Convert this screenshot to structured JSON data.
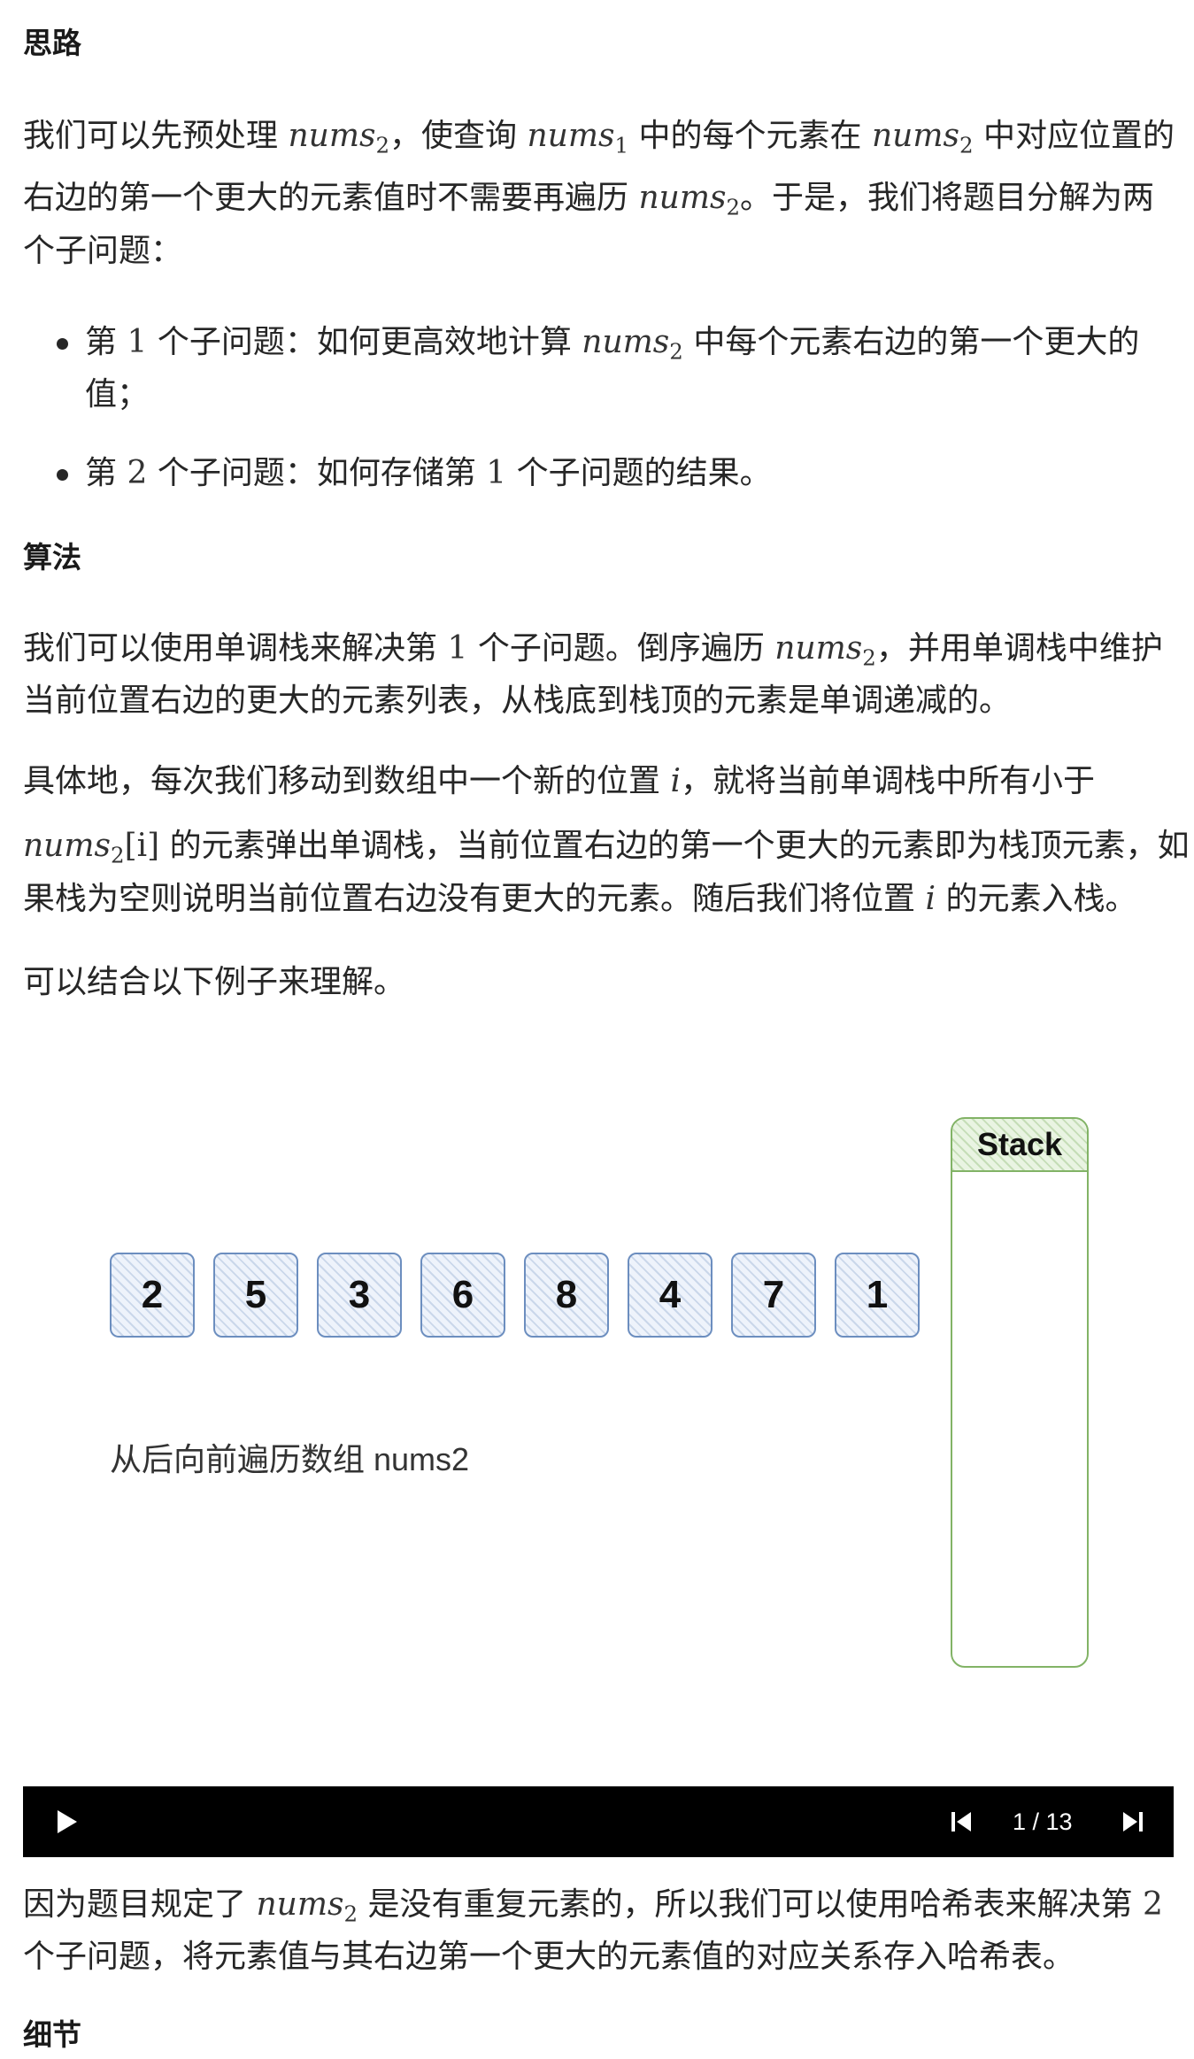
{
  "sections": {
    "thinking_title": "思路",
    "algorithm_title": "算法",
    "details_title": "细节"
  },
  "thinking": {
    "p1_l1_a": "我们可以先预处理",
    "p1_l1_b": "，使查询",
    "p1_l1_c": "中的每个元素在",
    "p1_l1_d": "中对应位置的",
    "p1_l2_a": "右边的第一个更大的元素值时不需要再遍历",
    "p1_l2_b": "。于是，我们将题目分解为两",
    "p1_l3": "个子问题：",
    "bullet1_a": "第",
    "bullet1_num": "1",
    "bullet1_b": "个子问题：如何更高效地计算",
    "bullet1_c": "中每个元素右边的第一个更大的",
    "bullet1_l2": "值；",
    "bullet2_a": "第",
    "bullet2_num": "2",
    "bullet2_b": "个子问题：如何存储第",
    "bullet2_num2": "1",
    "bullet2_c": "个子问题的结果。"
  },
  "math": {
    "nums": "nums",
    "sub1": "1",
    "sub2": "2",
    "idx": "[i]",
    "i": "i"
  },
  "algorithm": {
    "p1_l1_a": "我们可以使用单调栈来解决第",
    "p1_num": "1",
    "p1_l1_b": "个子问题。倒序遍历",
    "p1_l1_c": "，并用单调栈中维护",
    "p1_l2": "当前位置右边的更大的元素列表，从栈底到栈顶的元素是单调递减的。",
    "p2_l1_a": "具体地，每次我们移动到数组中一个新的位置",
    "p2_l1_b": "，就将当前单调栈中所有小于",
    "p2_l2_b": "的元素弹出单调栈，当前位置右边的第一个更大的元素即为栈顶元素，如",
    "p2_l3_a": "果栈为空则说明当前位置右边没有更大的元素。随后我们将位置",
    "p2_l3_b": "的元素入栈。",
    "p3": "可以结合以下例子来理解。"
  },
  "slide": {
    "array_values": [
      "2",
      "5",
      "3",
      "6",
      "8",
      "4",
      "7",
      "1"
    ],
    "stack_label": "Stack",
    "caption": "从后向前遍历数组 nums2"
  },
  "player": {
    "counter": "1 / 13",
    "play_icon": "play-icon",
    "prev_icon": "skip-previous-icon",
    "next_icon": "skip-next-icon"
  },
  "after": {
    "l1_a": "因为题目规定了",
    "l1_b": "是没有重复元素的，所以我们可以使用哈希表来解决第",
    "l1_num": "2",
    "l2": "个子问题，将元素值与其右边第一个更大的元素值的对应关系存入哈希表。"
  }
}
